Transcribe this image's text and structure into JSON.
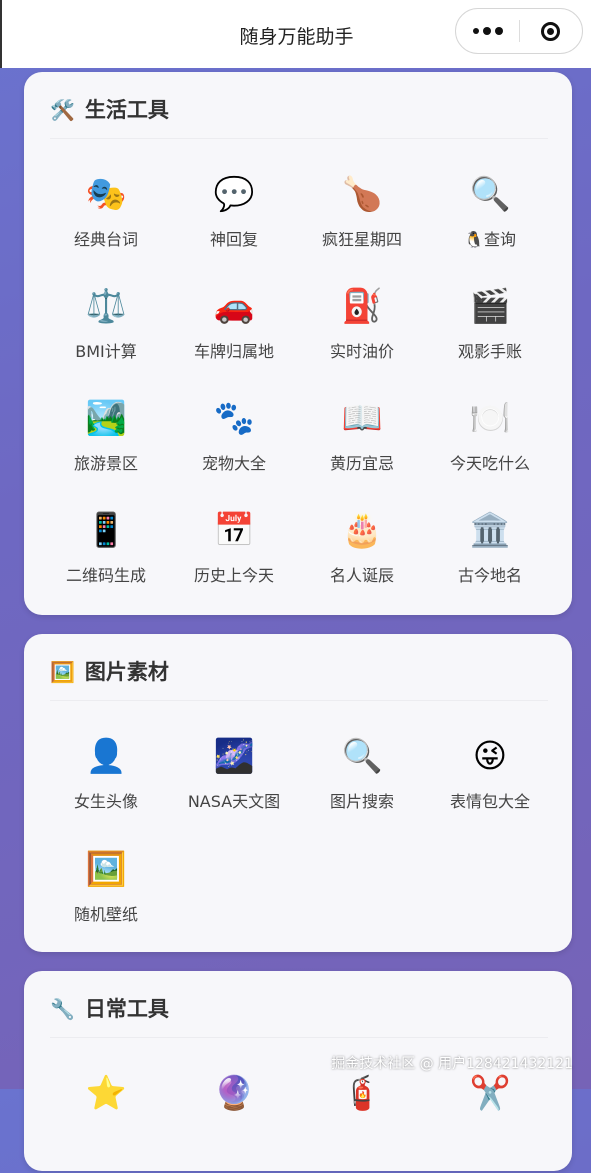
{
  "nav": {
    "title": "随身万能助手"
  },
  "sections": [
    {
      "icon": "🛠️",
      "icon_name": "tools-icon",
      "title": "生活工具",
      "items": [
        {
          "icon": "🎭",
          "name": "masks-icon",
          "label": "经典台词"
        },
        {
          "icon": "💬",
          "name": "speech-bubble-icon",
          "label": "神回复"
        },
        {
          "icon": "🍗",
          "name": "chicken-leg-icon",
          "label": "疯狂星期四"
        },
        {
          "icon": "🔍",
          "name": "magnifier-icon",
          "label": "🐧查询"
        },
        {
          "icon": "⚖️",
          "name": "scale-icon",
          "label": "BMI计算"
        },
        {
          "icon": "🚗",
          "name": "car-icon",
          "label": "车牌归属地"
        },
        {
          "icon": "⛽",
          "name": "fuel-pump-icon",
          "label": "实时油价"
        },
        {
          "icon": "🎬",
          "name": "clapperboard-icon",
          "label": "观影手账"
        },
        {
          "icon": "🏞️",
          "name": "landscape-icon",
          "label": "旅游景区"
        },
        {
          "icon": "🐾",
          "name": "paw-icon",
          "label": "宠物大全"
        },
        {
          "icon": "📖",
          "name": "book-icon",
          "label": "黄历宜忌"
        },
        {
          "icon": "🍽️",
          "name": "plate-icon",
          "label": "今天吃什么"
        },
        {
          "icon": "📱",
          "name": "phone-icon",
          "label": "二维码生成"
        },
        {
          "icon": "📅",
          "name": "calendar-icon",
          "label": "历史上今天"
        },
        {
          "icon": "🎂",
          "name": "cake-icon",
          "label": "名人诞辰"
        },
        {
          "icon": "🏛️",
          "name": "temple-icon",
          "label": "古今地名"
        }
      ]
    },
    {
      "icon": "🖼️",
      "icon_name": "picture-icon",
      "title": "图片素材",
      "items": [
        {
          "icon": "👤",
          "name": "person-icon",
          "label": "女生头像"
        },
        {
          "icon": "🌌",
          "name": "galaxy-icon",
          "label": "NASA天文图"
        },
        {
          "icon": "🔍",
          "name": "magnifier-icon",
          "label": "图片搜索"
        },
        {
          "icon": "😜",
          "name": "smiley-icon",
          "label": "表情包大全"
        },
        {
          "icon": "🖼️",
          "name": "picture-icon",
          "label": "随机壁纸"
        }
      ]
    },
    {
      "icon": "🔧",
      "icon_name": "wrench-icon",
      "title": "日常工具",
      "items": [
        {
          "icon": "⭐",
          "name": "star-icon",
          "label": ""
        },
        {
          "icon": "🔮",
          "name": "crystal-ball-icon",
          "label": ""
        },
        {
          "icon": "🧯",
          "name": "extinguisher-icon",
          "label": ""
        },
        {
          "icon": "✂️",
          "name": "scissors-icon",
          "label": ""
        }
      ]
    }
  ],
  "watermark": "掘金技术社区 @ 用户128421432121"
}
